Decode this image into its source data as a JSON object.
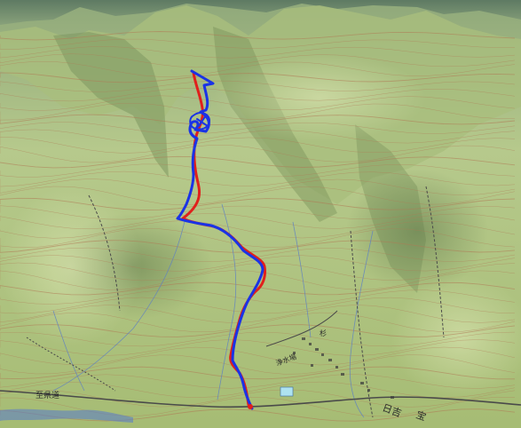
{
  "map": {
    "type": "3d-terrain-topographic",
    "colors": {
      "sky_ridge": "#6f8a66",
      "terrain_light": "#c6d49a",
      "terrain_mid": "#a9bd78",
      "terrain_shadow": "#6f8652",
      "contour": "#b07a55",
      "road": "#4a4a4a",
      "stream": "#5d7fc4",
      "track_red": "#e0201c",
      "track_blue": "#1a33e6",
      "pond": "#aee3f0"
    },
    "labels": [
      {
        "text": "至県道"
      },
      {
        "text": "浄水場"
      },
      {
        "text": "杉"
      },
      {
        "text": "日吉"
      },
      {
        "text": "宝"
      }
    ],
    "tracks": [
      {
        "name": "track-red",
        "color_key": "track_red"
      },
      {
        "name": "track-blue",
        "color_key": "track_blue"
      }
    ]
  }
}
